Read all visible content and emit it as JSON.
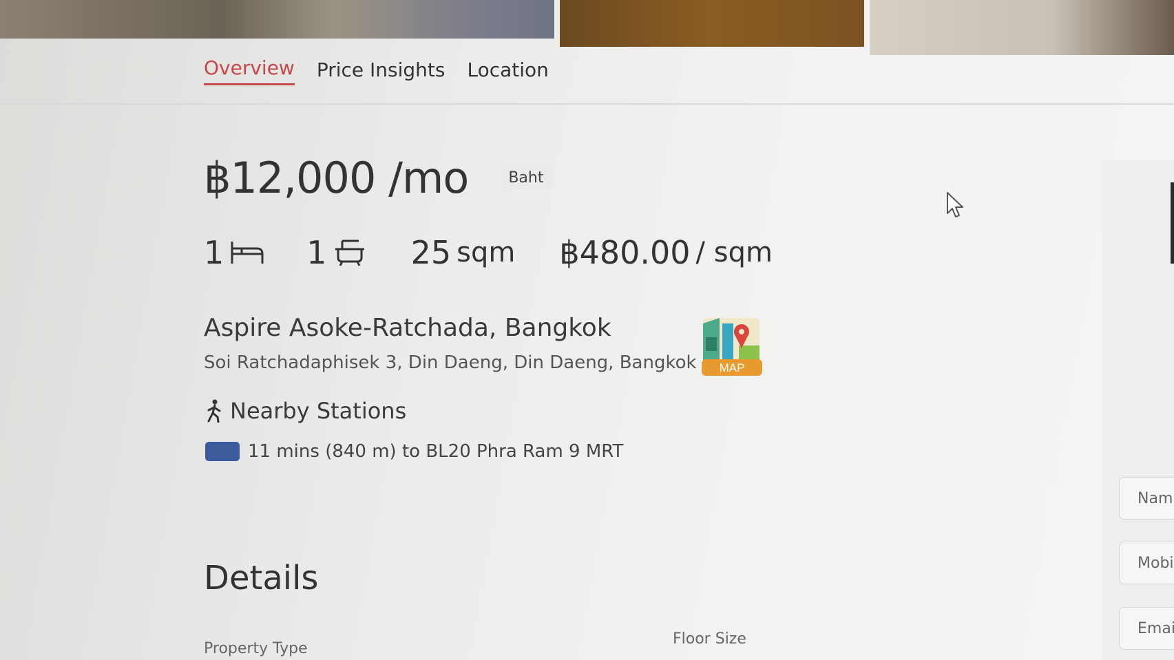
{
  "tabs": [
    {
      "label": "Overview",
      "active": true
    },
    {
      "label": "Price Insights",
      "active": false
    },
    {
      "label": "Location",
      "active": false
    }
  ],
  "listing": {
    "price": "฿12,000 /mo",
    "currency_label": "Baht",
    "bedrooms": "1",
    "bathrooms": "1",
    "area_value": "25",
    "area_unit": "sqm",
    "price_per_sqm_value": "฿480.00",
    "price_per_sqm_unit": "/ sqm",
    "building_name": "Aspire Asoke-Ratchada, Bangkok",
    "address": "Soi Ratchadaphisek 3, Din Daeng, Din Daeng, Bangkok",
    "map_label": "MAP"
  },
  "nearby": {
    "title": "Nearby Stations",
    "stations": [
      {
        "text": "11 mins (840 m) to BL20 Phra Ram 9 MRT",
        "line_color": "#3d5a9b"
      }
    ]
  },
  "details": {
    "title": "Details",
    "property_type_label": "Property Type",
    "floor_size_label": "Floor Size"
  },
  "contact_form": {
    "name_placeholder": "Nam",
    "mobile_placeholder": "Mobi",
    "email_placeholder": "Emai"
  },
  "colors": {
    "accent": "#c6474a",
    "mrt_blue_line": "#3d5a9b"
  },
  "icons": {
    "bed": "bed-icon",
    "bath": "bathtub-icon",
    "map": "map-pin-icon",
    "walk": "walking-person-icon",
    "cursor": "mouse-cursor-icon"
  }
}
